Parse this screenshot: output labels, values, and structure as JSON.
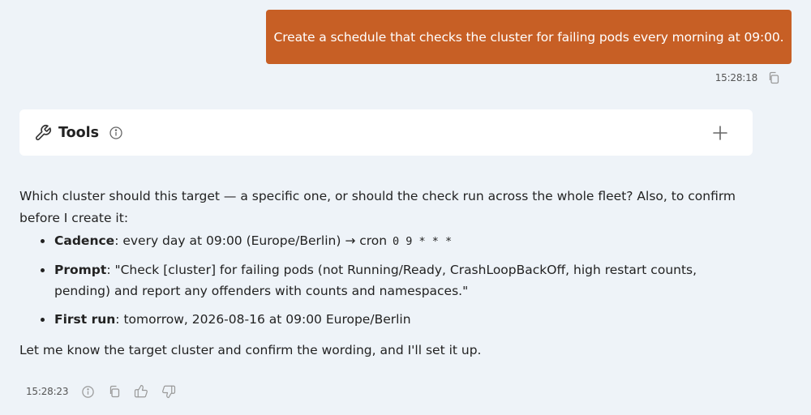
{
  "user_message": {
    "text": "Create a schedule that checks the cluster for failing pods every morning at 09:00.",
    "timestamp": "15:28:18"
  },
  "tools_panel": {
    "title": "Tools"
  },
  "assistant_message": {
    "intro": "Which cluster should this target — a specific one, or should the check run across the whole fleet? Also, to confirm before I create it:",
    "items": [
      {
        "label": "Cadence",
        "text": ": every day at 09:00 (Europe/Berlin) → cron ",
        "code": "0 9 * * *"
      },
      {
        "label": "Prompt",
        "text": ": \"Check [cluster] for failing pods (not Running/Ready, CrashLoopBackOff, high restart counts, pending) and report any offenders with counts and namespaces.\""
      },
      {
        "label": "First run",
        "text": ": tomorrow, 2026-08-16 at 09:00 Europe/Berlin"
      }
    ],
    "closing": "Let me know the target cluster and confirm the wording, and I'll set it up.",
    "timestamp": "15:28:23"
  },
  "colors": {
    "background": "#eef3f8",
    "user_bubble": "#c75f25",
    "card": "#ffffff",
    "icon": "#888888"
  },
  "icons": [
    "copy-icon",
    "wrench-icon",
    "info-icon",
    "plus-icon",
    "thumbs-up-icon",
    "thumbs-down-icon"
  ]
}
